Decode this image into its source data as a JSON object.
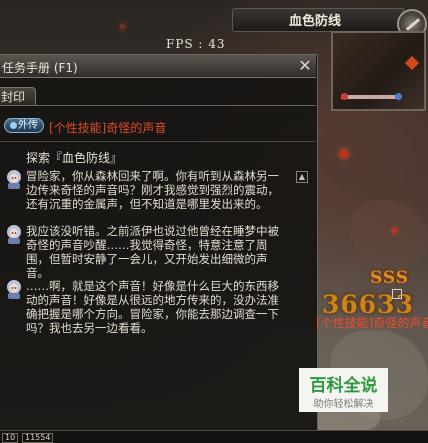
{
  "hud": {
    "fps_label": "FPS : 43",
    "map_title": "血色防线",
    "combo_text": "SSS",
    "damage_number": "36633",
    "side_quest_text": "[个性技能]奇怪的声音"
  },
  "quest_window": {
    "title": "任务手册 (F1)",
    "close_label": "✕",
    "tab_label": "封印",
    "quest_type_badge": "外传",
    "quest_name": "[个性技能]奇怪的声音",
    "section_title": "探索『血色防线』",
    "dialogs": [
      {
        "text": "冒险家，你从森林回来了啊。你有听到从森林另一边传来奇怪的声音吗？刚才我感觉到强烈的震动，还有沉重的金属声，但不知道是哪里发出来的。"
      },
      {
        "text": "我应该没听错。之前派伊也说过他曾经在睡梦中被奇怪的声音吵醒……我觉得奇怪，特意注意了周围，但暂时安静了一会儿，又开始发出细微的声音。"
      },
      {
        "text": "……啊，就是这个声音！好像是什么巨大的东西移动的声音！好像是从很远的地方传来的，没办法准确把握是哪个方向。冒险家，你能去那边调查一下吗？我也去另一边看看。"
      }
    ]
  },
  "watermark": {
    "title": "百科全说",
    "subtitle": "助你轻松解决"
  },
  "bottom_bar": {
    "chip_left": "10",
    "chip_count": "11554"
  }
}
